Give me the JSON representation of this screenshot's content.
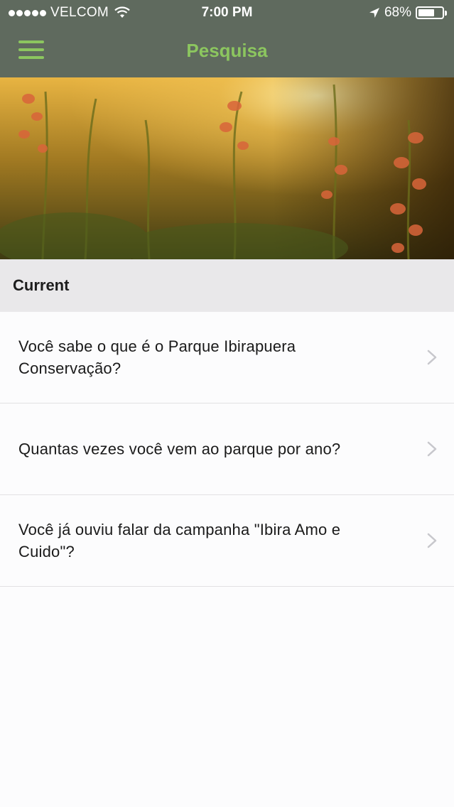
{
  "status_bar": {
    "carrier": "VELCOM",
    "time": "7:00 PM",
    "battery_text": "68%",
    "battery_level": 0.68
  },
  "nav": {
    "title": "Pesquisa",
    "menu_icon": "hamburger-menu-icon"
  },
  "hero": {
    "description": "sunlit wildflowers photo"
  },
  "section": {
    "label": "Current"
  },
  "surveys": [
    {
      "question": "Você sabe o que é o Parque Ibirapuera Conservação?"
    },
    {
      "question": "Quantas vezes você vem ao parque por ano?"
    },
    {
      "question": "Você já ouviu falar da campanha \"Ibira Amo e Cuido\"?"
    }
  ],
  "colors": {
    "nav_bar": "#5f6a5e",
    "accent": "#8cc65f",
    "section_bg": "#e9e8ea"
  }
}
